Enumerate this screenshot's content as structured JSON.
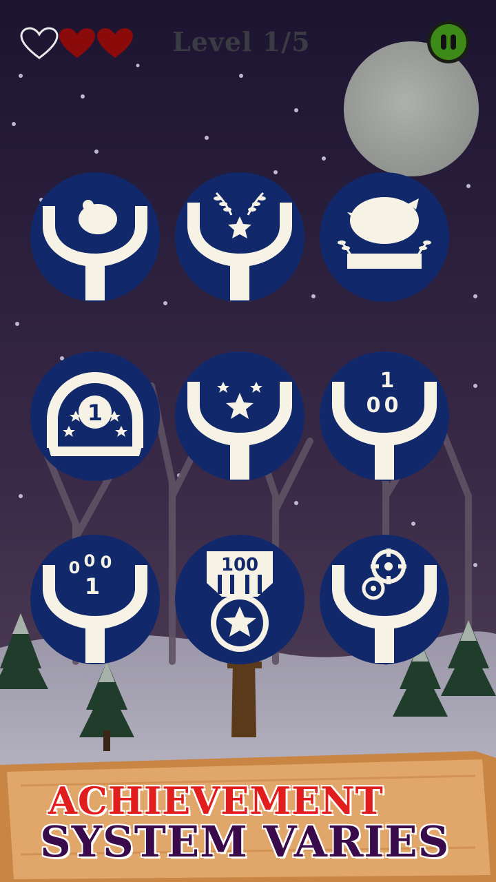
{
  "hud": {
    "level_label": "Level 1/5",
    "lives_total": 3,
    "lives_remaining": 2,
    "pause_icon": "pause-icon"
  },
  "achievements": [
    {
      "icon": "slingshot-bird-icon"
    },
    {
      "icon": "slingshot-laurel-star-icon"
    },
    {
      "icon": "pig-laurel-banner-icon"
    },
    {
      "icon": "rank-one-stars-banner-icon"
    },
    {
      "icon": "slingshot-three-stars-icon"
    },
    {
      "icon": "slingshot-100-icon"
    },
    {
      "icon": "slingshot-1000-icon"
    },
    {
      "icon": "medal-100-star-icon"
    },
    {
      "icon": "slingshot-crosshair-icon"
    }
  ],
  "banner": {
    "line1": "ACHIEVEMENT",
    "line2": "SYSTEM VARIES"
  },
  "colors": {
    "sky_top": "#1a1230",
    "sky_bottom": "#4a3550",
    "badge_fill": "#11286a",
    "badge_icon": "#f6f3e6",
    "level_text": "#3b3b43",
    "pause_green": "#3e8a18",
    "banner_red": "#e21d1d",
    "banner_purple": "#3a0b4a",
    "wood": "#d99758"
  }
}
